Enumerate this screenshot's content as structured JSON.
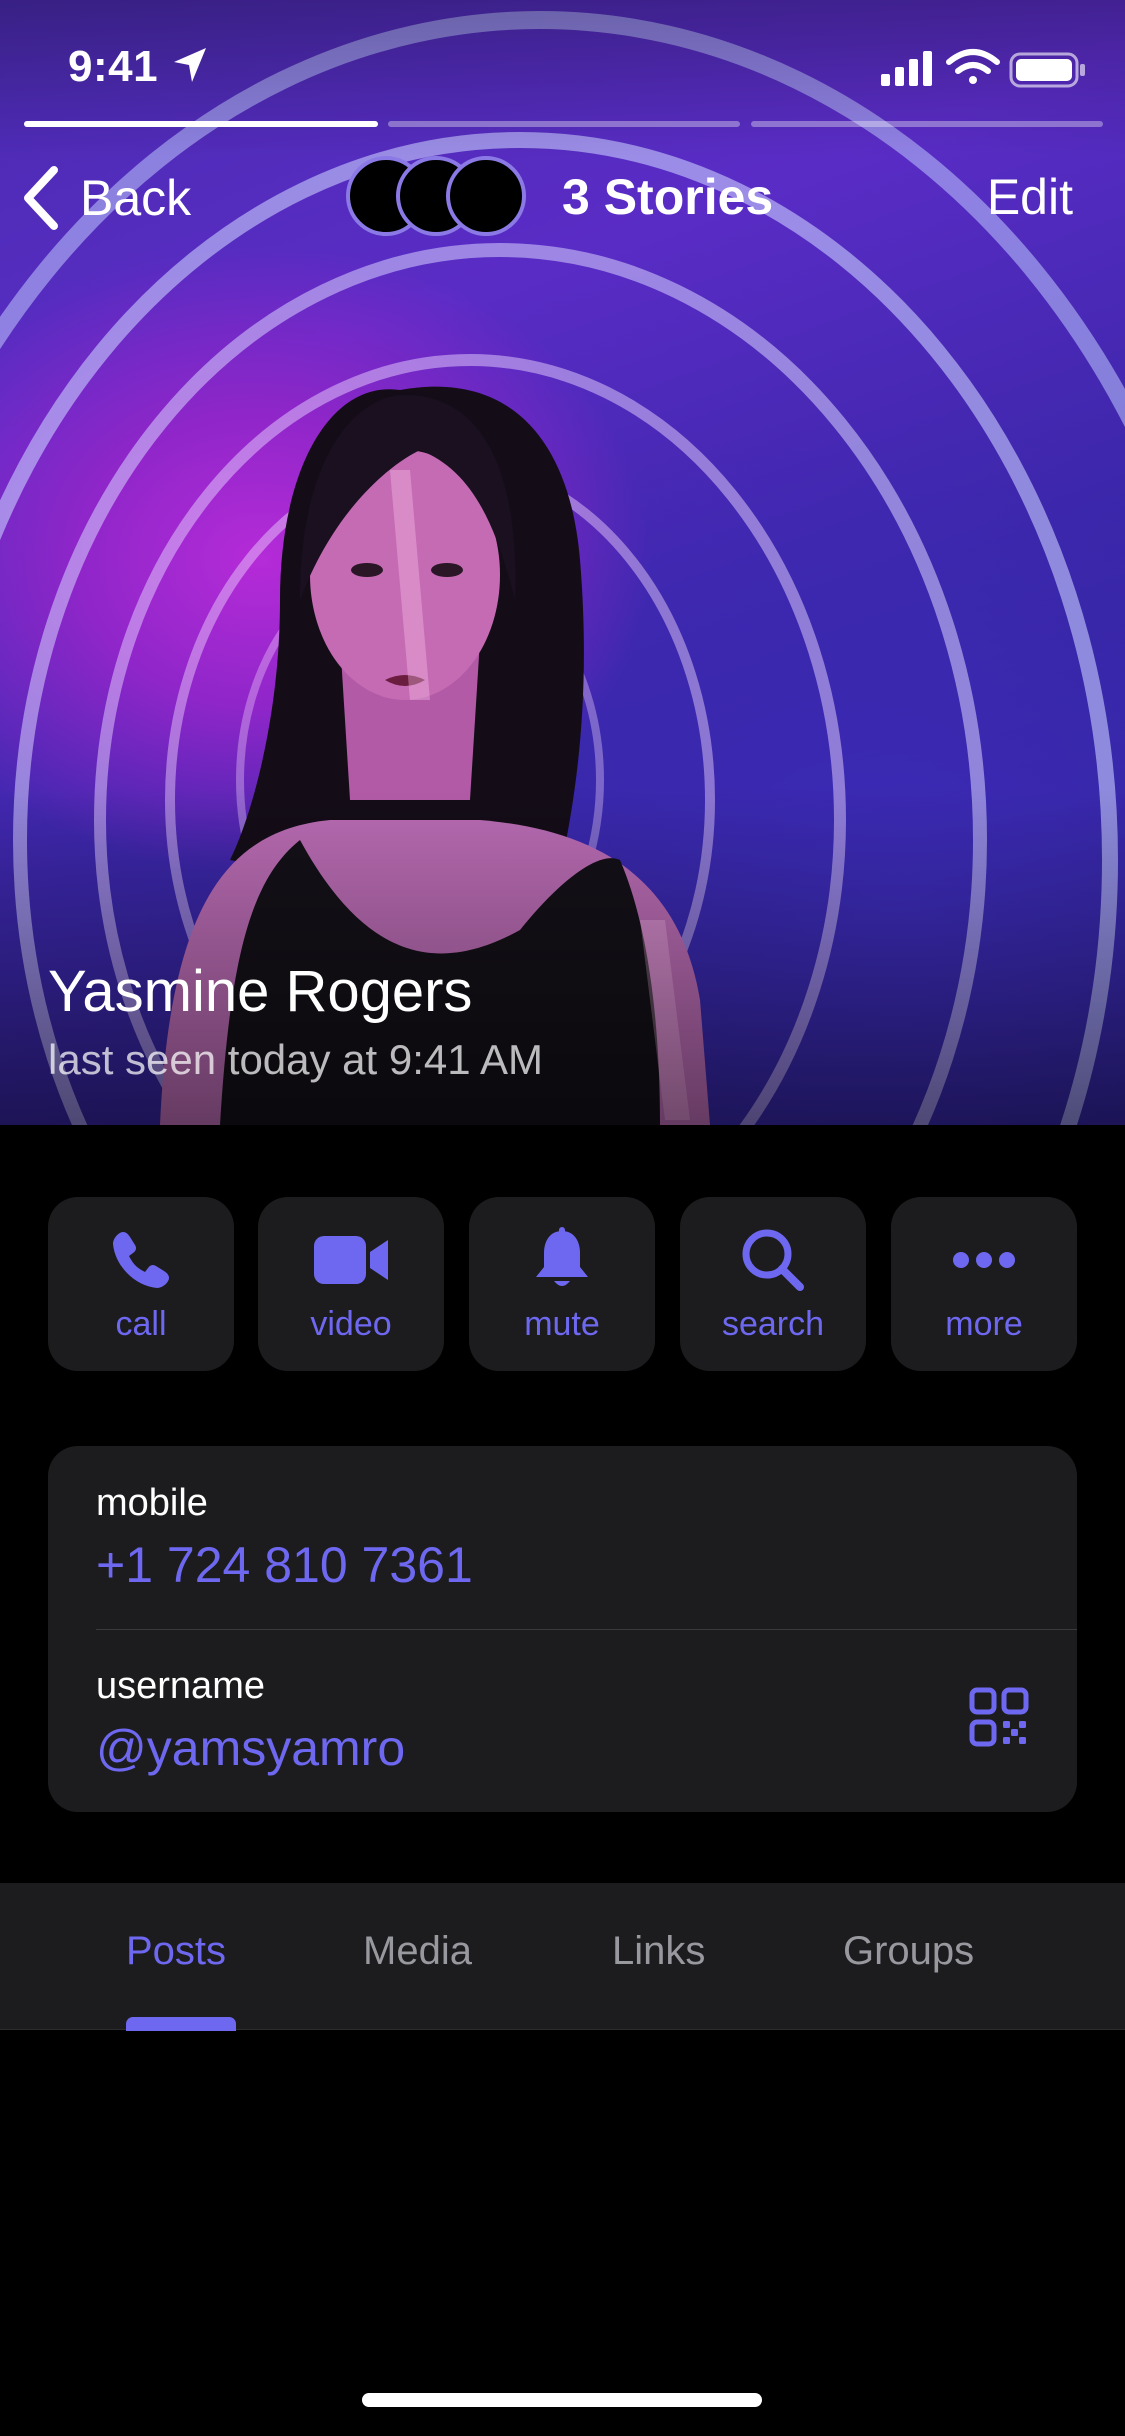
{
  "status_bar": {
    "time": "9:41",
    "icons": [
      "location-arrow-icon",
      "signal-icon",
      "wifi-icon",
      "battery-icon"
    ]
  },
  "story_progress": [
    1,
    0,
    0
  ],
  "nav": {
    "back_label": "Back",
    "stories_label": "3 Stories",
    "edit_label": "Edit"
  },
  "profile": {
    "name": "Yasmine Rogers",
    "last_seen": "last seen today at 9:41 AM"
  },
  "actions": [
    {
      "label": "call",
      "icon": "phone-icon"
    },
    {
      "label": "video",
      "icon": "video-camera-icon"
    },
    {
      "label": "mute",
      "icon": "bell-icon"
    },
    {
      "label": "search",
      "icon": "search-icon"
    },
    {
      "label": "more",
      "icon": "ellipsis-icon"
    }
  ],
  "info": {
    "mobile_label": "mobile",
    "mobile_value": "+1 724 810 7361",
    "username_label": "username",
    "username_value": "@yamsyamro"
  },
  "tabs": [
    {
      "label": "Posts",
      "active": true
    },
    {
      "label": "Media",
      "active": false
    },
    {
      "label": "Links",
      "active": false
    },
    {
      "label": "Groups",
      "active": false
    }
  ],
  "colors": {
    "accent": "#6E68F0",
    "card_background": "#1C1C1E",
    "page_background": "#000000"
  }
}
